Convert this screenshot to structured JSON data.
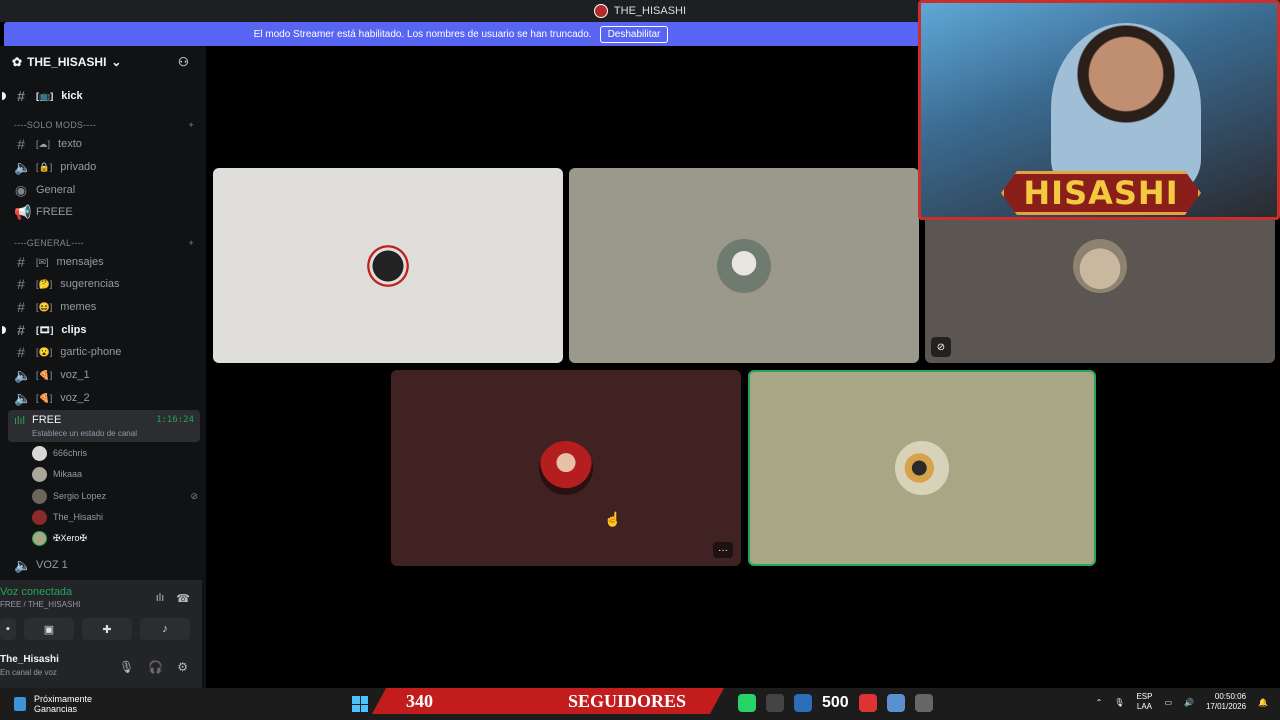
{
  "titlebar": {
    "title": "THE_HISASHI"
  },
  "banner": {
    "message": "El modo Streamer está habilitado. Los nombres de usuario se han truncado.",
    "button": "Deshabilitar"
  },
  "server": {
    "name": "THE_HISASHI",
    "chevron": "⌄"
  },
  "channels": {
    "kick": "kick",
    "cat_solo_mods": "----SOLO MODS----",
    "texto": "texto",
    "privado": "privado",
    "general_voice": "General",
    "freee": "FREEE",
    "cat_general": "----GENERAL----",
    "mensajes": "mensajes",
    "sugerencias": "sugerencias",
    "memes": "memes",
    "clips": "clips",
    "gartic": "gartic-phone",
    "voz1": "voz_1",
    "voz2": "voz_2",
    "voz1_upper": "VOZ 1"
  },
  "voice_channel": {
    "name": "FREE",
    "timer": "1:16:24",
    "status_placeholder": "Establece un estado de canal",
    "users": [
      "666chris",
      "Mikaaa",
      "Sergio Lopez",
      "The_Hisashi",
      "✠Xero✠"
    ]
  },
  "voice_panel": {
    "status": "Voz conectada",
    "sub": "FREE / THE_HISASHI",
    "username": "The_Hisashi",
    "user_status": "En canal de voz"
  },
  "webcam": {
    "name": "HISASHI"
  },
  "taskbar": {
    "widget_title": "Próximamente",
    "widget_sub": "Ganancias",
    "followers_count": "340",
    "followers_label": "SEGUIDORES",
    "badge_number": "500",
    "lang_top": "ESP",
    "lang_bottom": "LAA",
    "time": "00:50:06",
    "date": "17/01/2026"
  },
  "colors": {
    "accent": "#5865f2",
    "voice_green": "#23a55a",
    "tile1": "#e0dedb",
    "tile2": "#9a998b",
    "tile3": "#5b5651",
    "tile4": "#3f2221",
    "tile5": "#a7a685",
    "followers_bar": "#c21c1c"
  }
}
